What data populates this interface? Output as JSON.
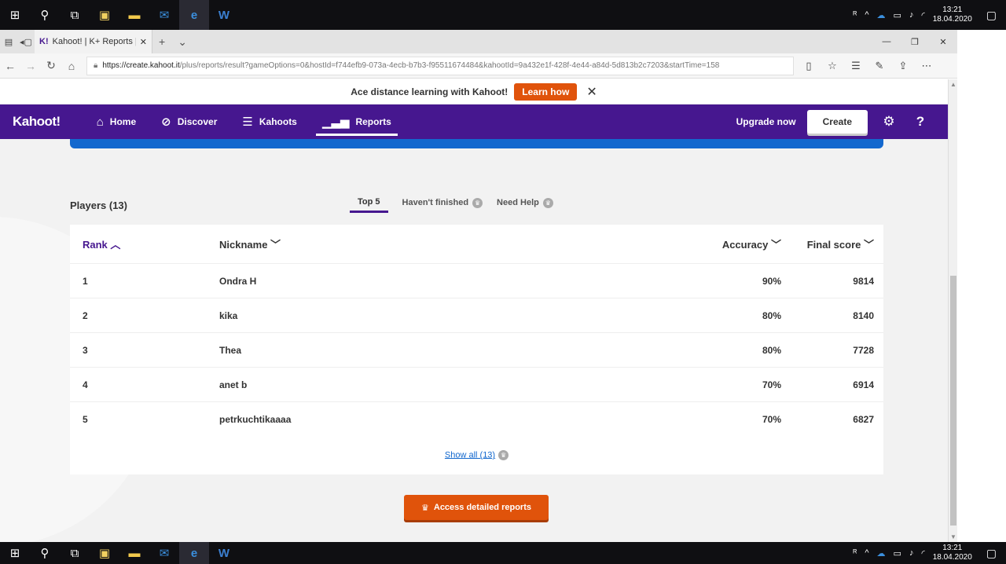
{
  "taskbar": {
    "apps": [
      "windows-start",
      "search",
      "task-view",
      "store",
      "file-explorer",
      "mail",
      "edge",
      "word"
    ],
    "clock_time": "13:21",
    "clock_date": "18.04.2020"
  },
  "browser": {
    "tab_title": "Kahoot! | K+ Reports | R",
    "tab_favicon": "K!",
    "url_host": "https://create.kahoot.it",
    "url_path": "/plus/reports/result?gameOptions=0&hostId=f744efb9-073a-4ecb-b7b3-f95511674484&kahootId=9a432e1f-428f-4e44-a84d-5d813b2c7203&startTime=158"
  },
  "banner": {
    "text": "Ace distance learning with Kahoot!",
    "button": "Learn how"
  },
  "nav": {
    "logo": "Kahoot!",
    "items": [
      "Home",
      "Discover",
      "Kahoots",
      "Reports"
    ],
    "upgrade": "Upgrade now",
    "create": "Create"
  },
  "players": {
    "title": "Players (13)",
    "tabs": [
      "Top 5",
      "Haven't finished",
      "Need Help"
    ]
  },
  "table": {
    "headers": [
      "Rank",
      "Nickname",
      "Accuracy",
      "Final score"
    ],
    "rows": [
      [
        "1",
        "Ondra H",
        "90%",
        "9814"
      ],
      [
        "2",
        "kika",
        "80%",
        "8140"
      ],
      [
        "3",
        "Thea",
        "80%",
        "7728"
      ],
      [
        "4",
        "anet b",
        "70%",
        "6914"
      ],
      [
        "5",
        "petrkuchtikaaaa",
        "70%",
        "6827"
      ]
    ],
    "show_all": "Show all (13)"
  },
  "detailed_button": "Access detailed reports",
  "colors": {
    "brand_purple": "#46178f",
    "accent_orange": "#e0530b",
    "blue": "#1368ce"
  }
}
